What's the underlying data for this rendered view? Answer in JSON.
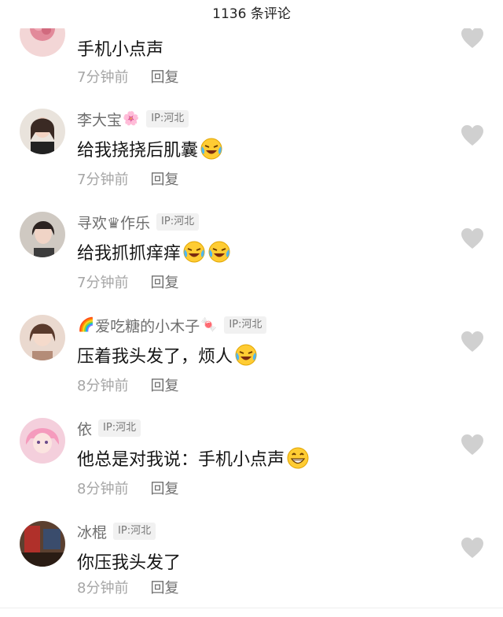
{
  "header": {
    "title": "1136 条评论"
  },
  "comments": [
    {
      "name": "",
      "name_suffix": "",
      "ip": "",
      "text": "手机小点声",
      "time": "7分钟前",
      "reply": "回复"
    },
    {
      "name": "李大宝",
      "name_suffix": "🌸",
      "ip": "IP:河北",
      "text": "给我挠挠后肌囊",
      "time": "7分钟前",
      "reply": "回复"
    },
    {
      "name": "寻欢♛作乐",
      "name_suffix": "",
      "ip": "IP:河北",
      "text": "给我抓抓痒痒",
      "time": "7分钟前",
      "reply": "回复"
    },
    {
      "name_prefix": "🌈",
      "name": "爱吃糖的小木子",
      "name_suffix": "🍬",
      "ip": "IP:河北",
      "text": "压着我头发了，烦人",
      "time": "8分钟前",
      "reply": "回复"
    },
    {
      "name": "依",
      "name_suffix": "",
      "ip": "IP:河北",
      "text": "他总是对我说：手机小点声",
      "time": "8分钟前",
      "reply": "回复"
    },
    {
      "name": "冰棍",
      "name_suffix": "",
      "ip": "IP:河北",
      "text": "你压我头发了",
      "time": "8分钟前",
      "reply": "回复"
    }
  ],
  "icons": {
    "like": "heart-icon",
    "laugh_emoji": "laughing-crying-emoji"
  },
  "colors": {
    "heart": "#d0d0d0",
    "ip_badge_bg": "#f1f1f1",
    "meta_text": "#a6a6a6"
  }
}
